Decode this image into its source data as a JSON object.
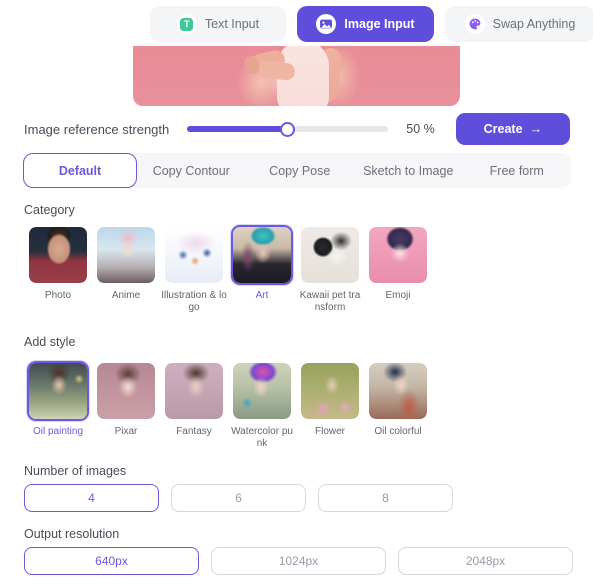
{
  "tabs": [
    {
      "label": "Text Input",
      "icon": "text-input-icon",
      "active": false
    },
    {
      "label": "Image Input",
      "icon": "image-input-icon",
      "active": true
    },
    {
      "label": "Swap Anything",
      "icon": "swap-anything-icon",
      "active": false
    }
  ],
  "preview": {
    "alt": "reference-photo-preview"
  },
  "strength": {
    "label": "Image reference strength",
    "value": 50,
    "value_display": "50 %",
    "fill_percent": 50
  },
  "create": {
    "label": "Create",
    "arrow": "→"
  },
  "modes": [
    {
      "label": "Default",
      "active": true
    },
    {
      "label": "Copy Contour",
      "active": false
    },
    {
      "label": "Copy Pose",
      "active": false
    },
    {
      "label": "Sketch to Image",
      "active": false
    },
    {
      "label": "Free form",
      "active": false
    }
  ],
  "category": {
    "title": "Category",
    "items": [
      {
        "label": "Photo",
        "art": "t-photo",
        "selected": false
      },
      {
        "label": "Anime",
        "art": "t-anime",
        "selected": false
      },
      {
        "label": "Illustration & logo",
        "art": "t-illus",
        "selected": false
      },
      {
        "label": "Art",
        "art": "t-art",
        "selected": true
      },
      {
        "label": "Kawaii pet transform",
        "art": "t-cat",
        "selected": false
      },
      {
        "label": "Emoji",
        "art": "t-emoji",
        "selected": false
      }
    ]
  },
  "add_style": {
    "title": "Add style",
    "items": [
      {
        "label": "Oil painting",
        "art": "t-oil",
        "selected": true
      },
      {
        "label": "Pixar",
        "art": "t-pixar",
        "selected": false
      },
      {
        "label": "Fantasy",
        "art": "t-fantasy",
        "selected": false
      },
      {
        "label": "Watercolor punk",
        "art": "t-watercolor",
        "selected": false
      },
      {
        "label": "Flower",
        "art": "t-flower",
        "selected": false
      },
      {
        "label": "Oil colorful",
        "art": "t-oilcolor",
        "selected": false
      }
    ]
  },
  "number_of_images": {
    "title": "Number of images",
    "options": [
      {
        "label": "4",
        "active": true
      },
      {
        "label": "6",
        "active": false
      },
      {
        "label": "8",
        "active": false
      }
    ]
  },
  "output_resolution": {
    "title": "Output resolution",
    "options": [
      {
        "label": "640px",
        "active": true
      },
      {
        "label": "1024px",
        "active": false
      },
      {
        "label": "2048px",
        "active": false
      }
    ]
  },
  "colors": {
    "accent": "#5f4ddb",
    "accent_soft": "#6a5ade",
    "tab_bg": "#f4f5f7",
    "text": "#4a4c57",
    "muted": "#9b9da6",
    "green": "#3fc79a"
  }
}
